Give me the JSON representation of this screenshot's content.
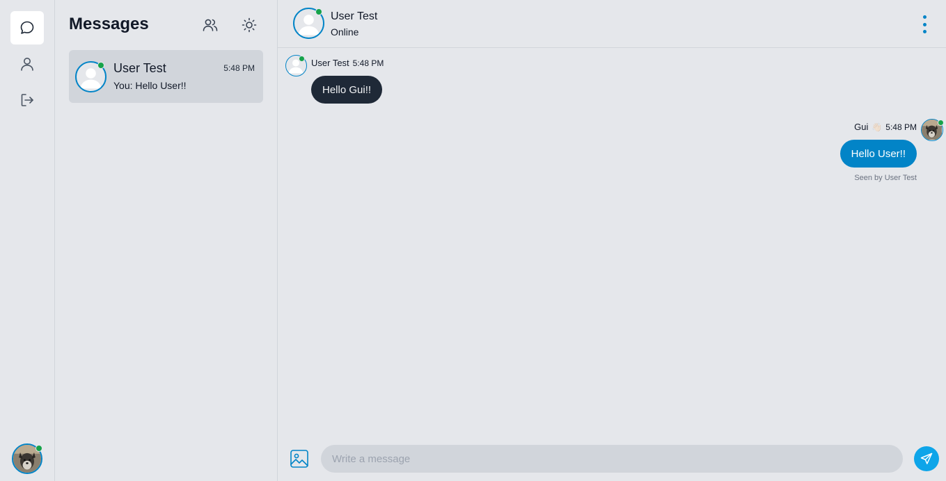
{
  "rail": {
    "items": [
      {
        "name": "chat-bubble-icon",
        "active": true
      },
      {
        "name": "user-icon",
        "active": false
      },
      {
        "name": "logout-icon",
        "active": false
      }
    ],
    "me_avatar": {
      "status": "online"
    }
  },
  "conversations": {
    "title": "Messages",
    "header_icons": [
      "users-icon",
      "sun-icon"
    ],
    "items": [
      {
        "name": "User Test",
        "time": "5:48 PM",
        "preview": "You: Hello User!!",
        "online": true,
        "selected": true
      }
    ]
  },
  "chat": {
    "header": {
      "name": "User Test",
      "status": "Online"
    },
    "menu_icon": "kebab-menu-icon",
    "messages": [
      {
        "direction": "incoming",
        "sender": "User Test",
        "time": "5:48 PM",
        "text": "Hello Gui!!"
      },
      {
        "direction": "outgoing",
        "sender": "Gui",
        "sender_emoji": "👋🏻",
        "time": "5:48 PM",
        "text": "Hello User!!",
        "seen": "Seen by User Test"
      }
    ],
    "composer": {
      "placeholder": "Write a message",
      "value": ""
    }
  },
  "colors": {
    "accent": "#0284c7",
    "send": "#0ea5e9",
    "background": "#e5e7eb",
    "incoming_bubble": "#1f2937",
    "online": "#16a34a"
  }
}
